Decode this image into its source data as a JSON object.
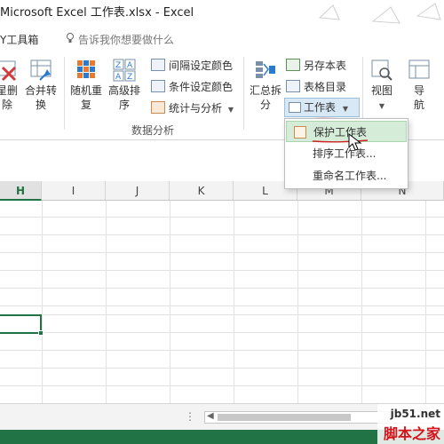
{
  "window": {
    "title": "Microsoft Excel 工作表.xlsx - Excel"
  },
  "tabs": {
    "partial_tab": "Y工具箱",
    "search_placeholder": "告诉我你想要做什么"
  },
  "ribbon": {
    "buttons": [
      {
        "l1": "星删",
        "l2": "除"
      },
      {
        "l1": "合并转",
        "l2": "换"
      },
      {
        "l1": "随机重",
        "l2": "复"
      },
      {
        "l1": "高级排",
        "l2": "序"
      }
    ],
    "small_buttons": [
      "间隔设定颜色",
      "条件设定颜色",
      "统计与分析"
    ],
    "huizong": {
      "l1": "汇总拆",
      "l2": "分"
    },
    "right_small": [
      "另存本表",
      "表格目录"
    ],
    "worksheet_button": "工作表",
    "view_button": "视图",
    "nav_button": {
      "l1": "导",
      "l2": "航"
    },
    "group_label": "数据分析"
  },
  "dropdown": {
    "items": [
      "保护工作表",
      "排序工作表...",
      "重命名工作表..."
    ],
    "highlighted": 0
  },
  "grid": {
    "columns": [
      "H",
      "I",
      "J",
      "K",
      "L",
      "M",
      "N"
    ],
    "selected_column": "H"
  },
  "watermark": {
    "line1": "jb51.net",
    "line2": "脚本之家"
  },
  "colors": {
    "excel_green": "#217346",
    "menu_highlight": "#d5ecd9"
  }
}
